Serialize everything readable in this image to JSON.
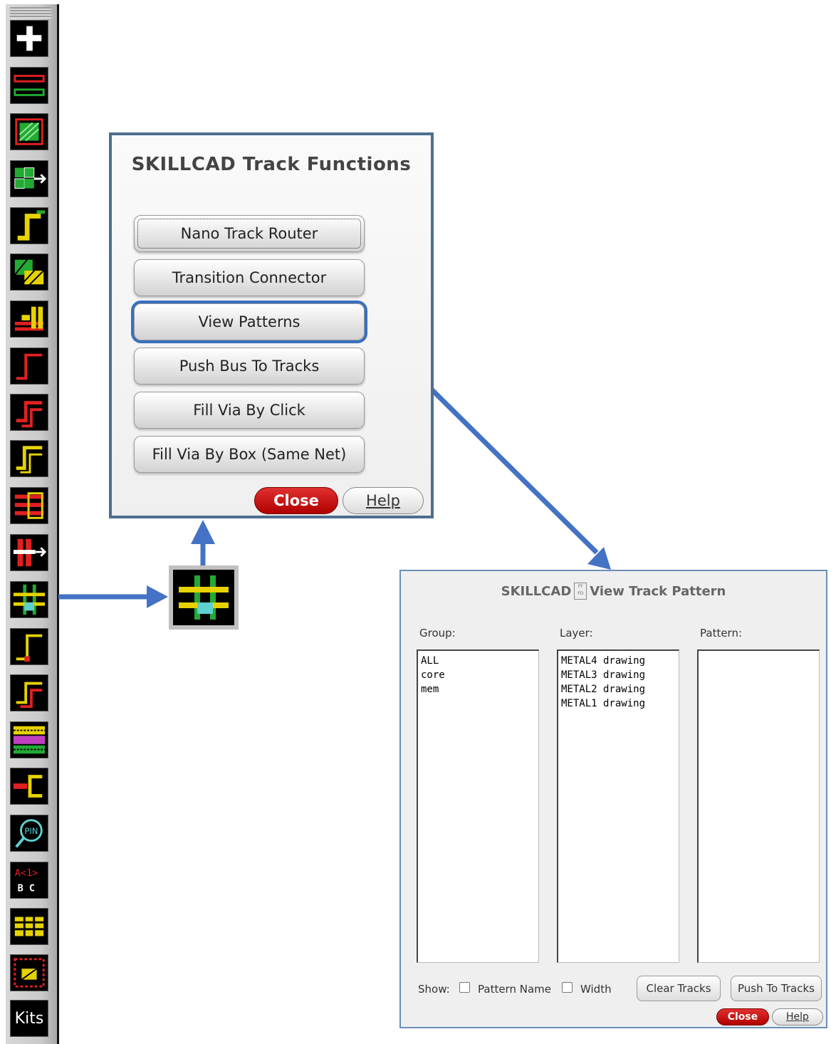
{
  "toolbar": {
    "kits_label": "Kits",
    "icons": [
      "add-icon",
      "ruler-icon",
      "fill-rect-icon",
      "move-array-icon",
      "step-route-icon",
      "hatch-icon",
      "bus-bar-icon",
      "corner-route-icon",
      "double-step-icon",
      "stair-route-icon",
      "stack-bars-icon",
      "via-push-icon",
      "track-grid-icon",
      "corner-small-icon",
      "step-small-icon",
      "layer-stack-icon",
      "connector-icon",
      "pin-search-icon",
      "bus-label-icon",
      "matrix-icon",
      "array-grid-icon"
    ]
  },
  "track_dialog": {
    "title": "SKILLCAD Track Functions",
    "buttons": [
      {
        "label": "Nano Track Router"
      },
      {
        "label": "Transition Connector"
      },
      {
        "label": "View Patterns"
      },
      {
        "label": "Push Bus To Tracks"
      },
      {
        "label": "Fill Via By Click"
      },
      {
        "label": "Fill Via By Box (Same Net)"
      }
    ],
    "close_label": "Close",
    "help_label": "Help"
  },
  "pattern_dialog": {
    "title_left": "SKILLCAD",
    "title_right": "View Track Pattern",
    "logo_text": "FF FD",
    "group_label": "Group:",
    "layer_label": "Layer:",
    "pattern_label": "Pattern:",
    "groups": [
      "ALL",
      "core",
      "mem"
    ],
    "layers": [
      "METAL4 drawing",
      "METAL3 drawing",
      "METAL2 drawing",
      "METAL1 drawing"
    ],
    "show_label": "Show:",
    "pattern_name_label": "Pattern Name",
    "width_label": "Width",
    "clear_tracks_label": "Clear Tracks",
    "push_to_tracks_label": "Push To Tracks",
    "close_label": "Close",
    "help_label": "Help"
  },
  "colors": {
    "accent_arrow": "#4472c4",
    "close_red": "#c00000",
    "track_green": "#22aa33",
    "track_yellow": "#e6d200",
    "track_cyan": "#5fd0d0"
  }
}
